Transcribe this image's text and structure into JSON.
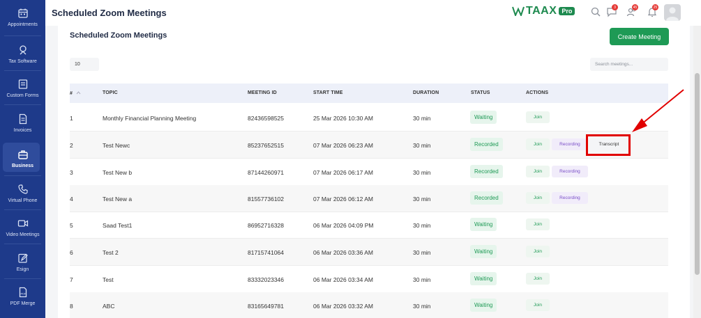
{
  "sidebar": {
    "items": [
      {
        "label": "Appointments",
        "icon": "calendar-icon"
      },
      {
        "label": "Tax Software",
        "icon": "tax-icon"
      },
      {
        "label": "Custom Forms",
        "icon": "form-icon"
      },
      {
        "label": "Invoices",
        "icon": "invoice-icon"
      },
      {
        "label": "Business",
        "icon": "briefcase-icon",
        "active": true
      },
      {
        "label": "Virtual Phone",
        "icon": "phone-icon"
      },
      {
        "label": "Video Meetings",
        "icon": "video-icon"
      },
      {
        "label": "Esign",
        "icon": "edit-icon"
      },
      {
        "label": "PDF Merge",
        "icon": "pdf-icon"
      }
    ]
  },
  "header": {
    "title": "Scheduled Zoom Meetings",
    "logo_text": "TAAX",
    "logo_badge": "Pro",
    "chat_count": "3",
    "users_count": "45",
    "bell_count": "25"
  },
  "main": {
    "title": "Scheduled Zoom Meetings",
    "create_label": "Create Meeting",
    "page_size": "10",
    "search_placeholder": "Search meetings...",
    "columns": {
      "num": "#",
      "topic": "TOPIC",
      "meeting_id": "MEETING ID",
      "start_time": "START TIME",
      "duration": "DURATION",
      "status": "STATUS",
      "actions": "ACTIONS"
    },
    "actions": {
      "join": "Join",
      "recording": "Recording",
      "transcript": "Transcript"
    },
    "rows": [
      {
        "num": "1",
        "topic": "Monthly Financial Planning Meeting",
        "meeting_id": "82436598525",
        "start_time": "25 Mar 2026 10:30 AM",
        "duration": "30 min",
        "status": "Waiting"
      },
      {
        "num": "2",
        "topic": "Test Newc",
        "meeting_id": "85237652515",
        "start_time": "07 Mar 2026 06:23 AM",
        "duration": "30 min",
        "status": "Recorded"
      },
      {
        "num": "3",
        "topic": "Test New b",
        "meeting_id": "87144260971",
        "start_time": "07 Mar 2026 06:17 AM",
        "duration": "30 min",
        "status": "Recorded"
      },
      {
        "num": "4",
        "topic": "Test New a",
        "meeting_id": "81557736102",
        "start_time": "07 Mar 2026 06:12 AM",
        "duration": "30 min",
        "status": "Recorded"
      },
      {
        "num": "5",
        "topic": "Saad Test1",
        "meeting_id": "86952716328",
        "start_time": "06 Mar 2026 04:09 PM",
        "duration": "30 min",
        "status": "Waiting"
      },
      {
        "num": "6",
        "topic": "Test 2",
        "meeting_id": "81715741064",
        "start_time": "06 Mar 2026 03:36 AM",
        "duration": "30 min",
        "status": "Waiting"
      },
      {
        "num": "7",
        "topic": "Test",
        "meeting_id": "83332023346",
        "start_time": "06 Mar 2026 03:34 AM",
        "duration": "30 min",
        "status": "Waiting"
      },
      {
        "num": "8",
        "topic": "ABC",
        "meeting_id": "83165649781",
        "start_time": "06 Mar 2026 03:32 AM",
        "duration": "30 min",
        "status": "Waiting"
      }
    ]
  },
  "colors": {
    "sidebar": "#1e3a8a",
    "accent": "#1e9a55",
    "recording": "#7a4ec8",
    "highlight": "#e10000"
  }
}
